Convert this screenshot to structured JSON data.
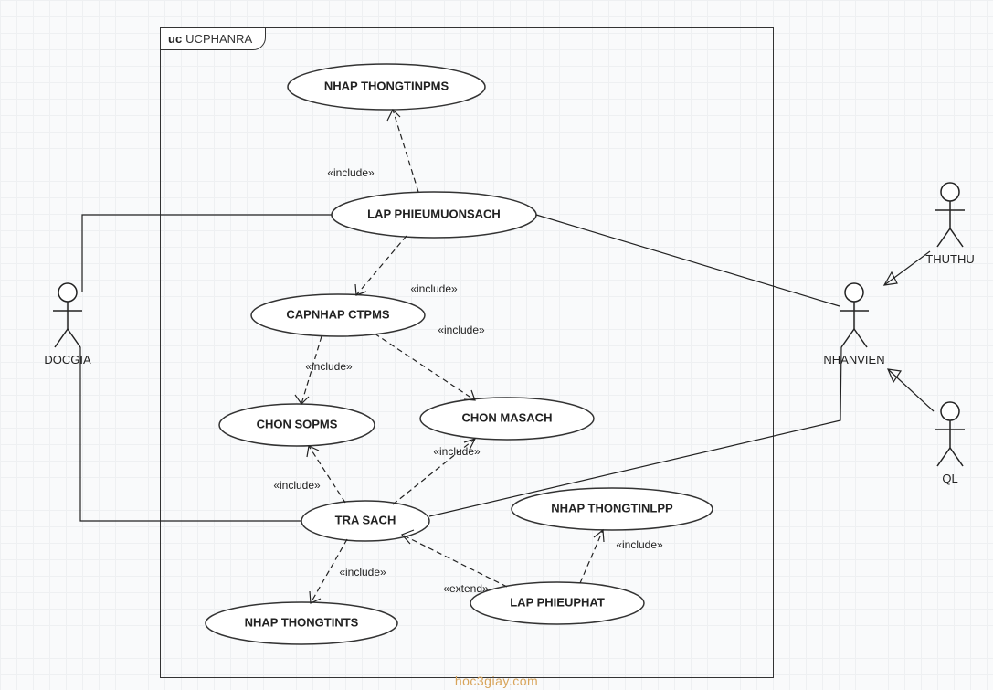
{
  "diagram_title_prefix": "uc",
  "diagram_title": "UCPHANRA",
  "watermark": "hoc3giay.com",
  "stereotypes": {
    "include": "«include»",
    "extend": "«extend»"
  },
  "actors": {
    "docgia": {
      "label": "DOCGIA"
    },
    "nhanvien": {
      "label": "NHANVIEN"
    },
    "thuthu": {
      "label": "THUTHU"
    },
    "ql": {
      "label": "QL"
    }
  },
  "usecases": {
    "nhap_thongtinpms": {
      "label": "NHAP THONGTINPMS"
    },
    "lap_phieumuonsach": {
      "label": "LAP PHIEUMUONSACH"
    },
    "capnhap_ctpms": {
      "label": "CAPNHAP CTPMS"
    },
    "chon_sopms": {
      "label": "CHON SOPMS"
    },
    "chon_masach": {
      "label": "CHON MASACH"
    },
    "tra_sach": {
      "label": "TRA SACH"
    },
    "nhap_thongtints": {
      "label": "NHAP THONGTINTS"
    },
    "lap_phieuphat": {
      "label": "LAP PHIEUPHAT"
    },
    "nhap_thongtinlpp": {
      "label": "NHAP THONGTINLPP"
    }
  },
  "relations": {
    "lap_pms__nhap_tpms": {
      "stereo": "include"
    },
    "lap_pms__cap_ctpms": {
      "stereo": "include"
    },
    "cap_ctpms__chon_sopms": {
      "stereo": "include"
    },
    "cap_ctpms__chon_masach": {
      "stereo": "include"
    },
    "tra__chon_sopms": {
      "stereo": "include"
    },
    "tra__chon_masach": {
      "stereo": "include"
    },
    "tra__nhap_thongtints": {
      "stereo": "include"
    },
    "lap_pp__tra": {
      "stereo": "extend"
    },
    "lap_pp__nhap_tlpp": {
      "stereo": "include"
    }
  },
  "chart_data": {
    "type": "uml-use-case",
    "system_boundary": "UCPHANRA",
    "actors": [
      "DOCGIA",
      "NHANVIEN",
      "THUTHU",
      "QL"
    ],
    "usecases": [
      "NHAP THONGTINPMS",
      "LAP PHIEUMUONSACH",
      "CAPNHAP CTPMS",
      "CHON SOPMS",
      "CHON MASACH",
      "TRA SACH",
      "NHAP THONGTINTS",
      "LAP PHIEUPHAT",
      "NHAP THONGTINLPP"
    ],
    "generalizations": [
      {
        "child": "THUTHU",
        "parent": "NHANVIEN"
      },
      {
        "child": "QL",
        "parent": "NHANVIEN"
      }
    ],
    "associations": [
      {
        "actor": "DOCGIA",
        "usecase": "LAP PHIEUMUONSACH"
      },
      {
        "actor": "DOCGIA",
        "usecase": "TRA SACH"
      },
      {
        "actor": "NHANVIEN",
        "usecase": "LAP PHIEUMUONSACH"
      },
      {
        "actor": "NHANVIEN",
        "usecase": "TRA SACH"
      }
    ],
    "dependencies": [
      {
        "from": "LAP PHIEUMUONSACH",
        "to": "NHAP THONGTINPMS",
        "type": "include"
      },
      {
        "from": "LAP PHIEUMUONSACH",
        "to": "CAPNHAP CTPMS",
        "type": "include"
      },
      {
        "from": "CAPNHAP CTPMS",
        "to": "CHON SOPMS",
        "type": "include"
      },
      {
        "from": "CAPNHAP CTPMS",
        "to": "CHON MASACH",
        "type": "include"
      },
      {
        "from": "TRA SACH",
        "to": "CHON SOPMS",
        "type": "include"
      },
      {
        "from": "TRA SACH",
        "to": "CHON MASACH",
        "type": "include"
      },
      {
        "from": "TRA SACH",
        "to": "NHAP THONGTINTS",
        "type": "include"
      },
      {
        "from": "LAP PHIEUPHAT",
        "to": "TRA SACH",
        "type": "extend"
      },
      {
        "from": "LAP PHIEUPHAT",
        "to": "NHAP THONGTINLPP",
        "type": "include"
      }
    ]
  }
}
